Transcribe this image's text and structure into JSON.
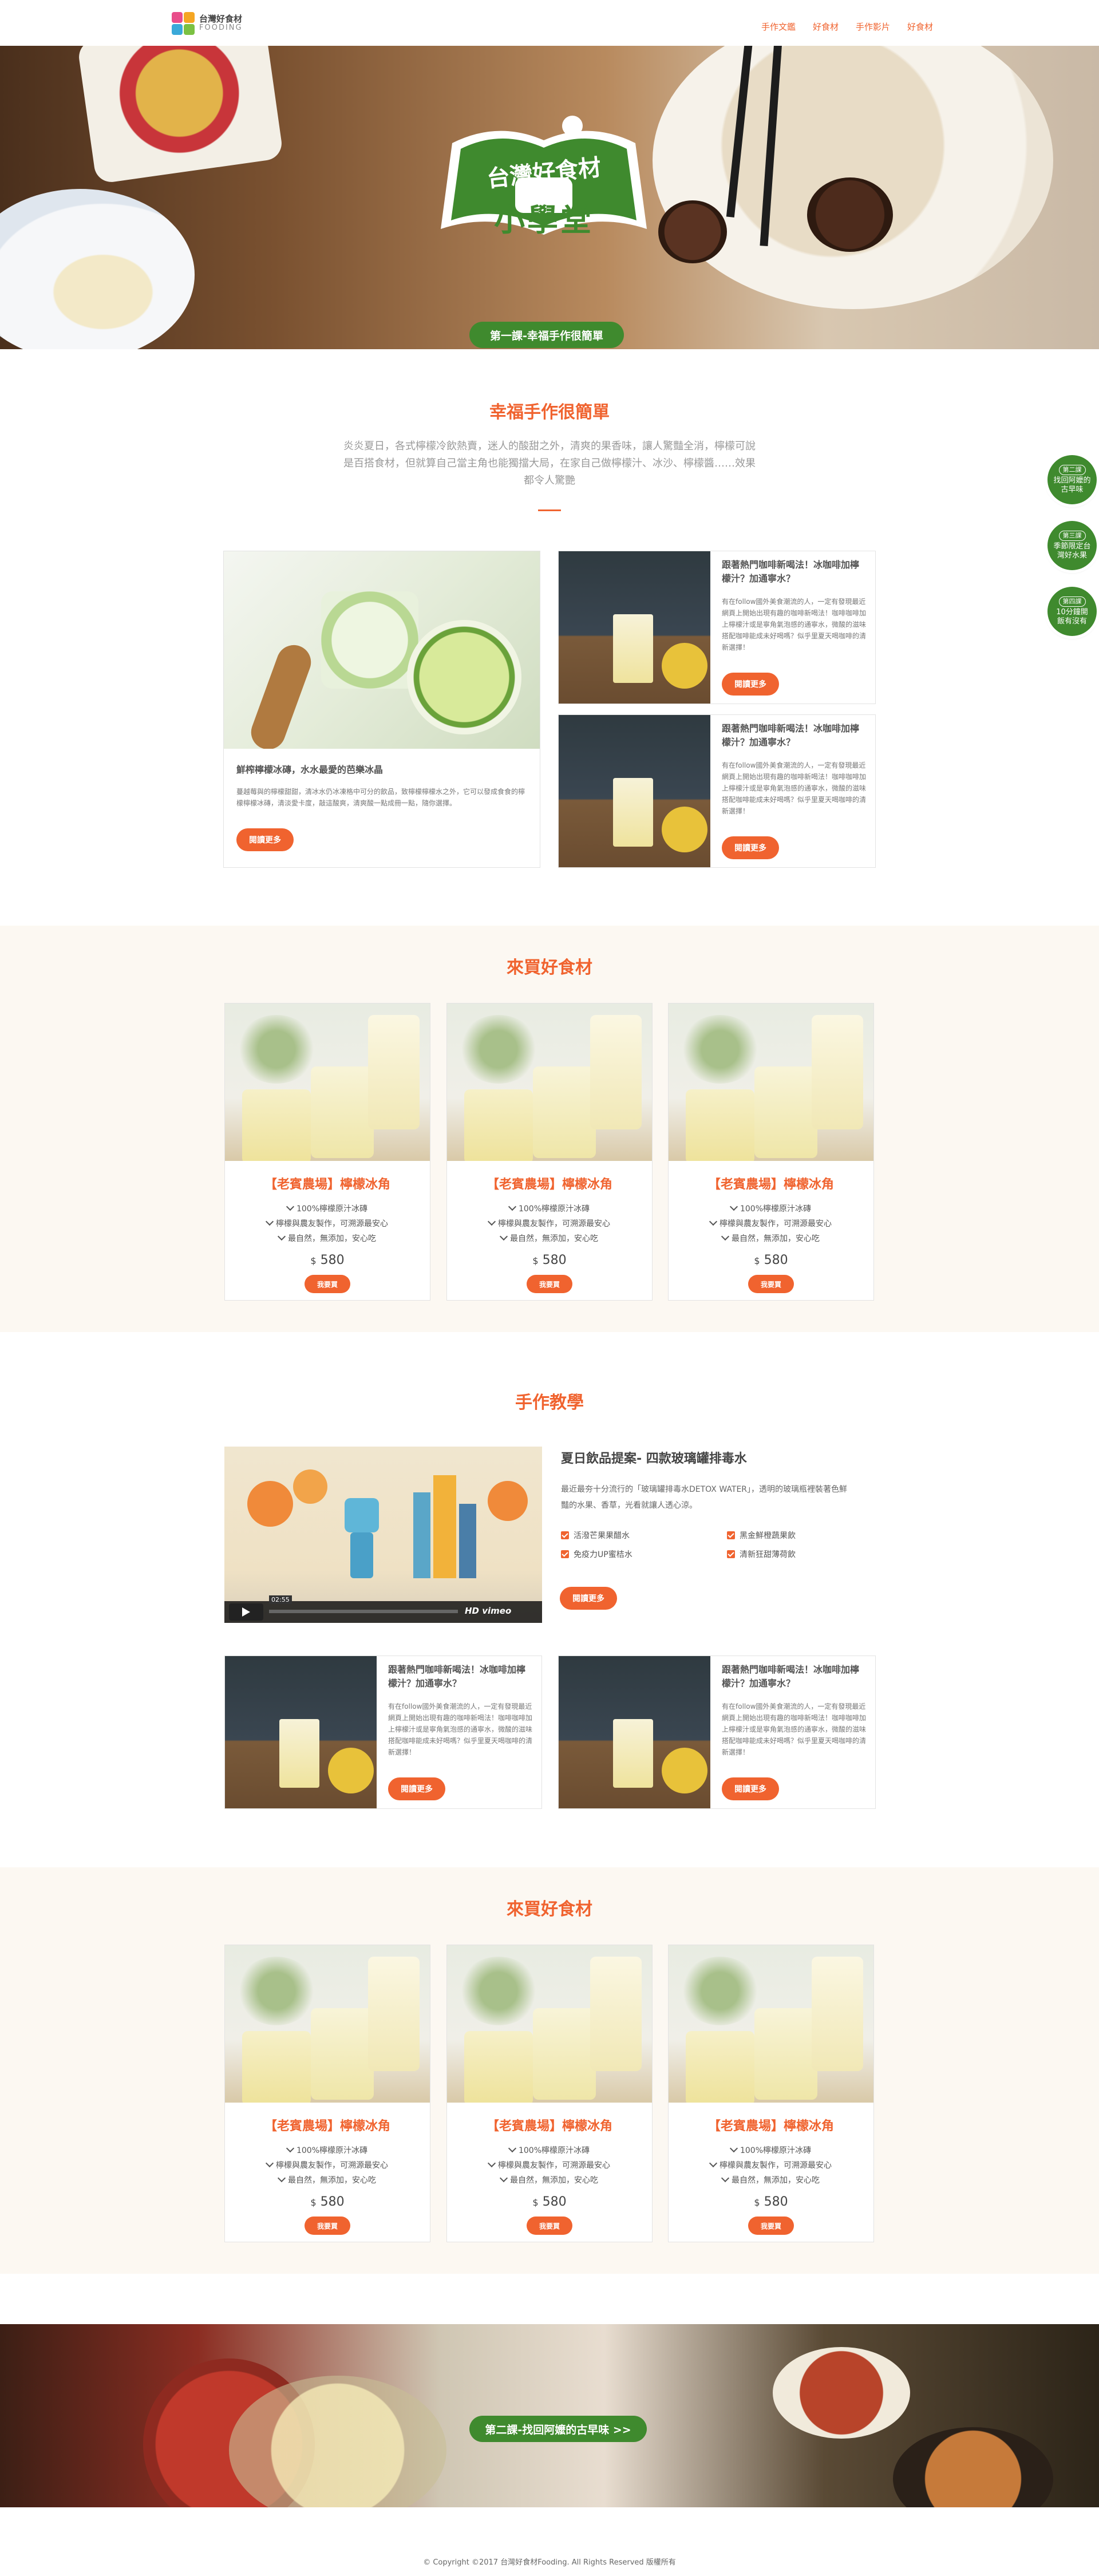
{
  "header": {
    "logo_title": "台灣好食材",
    "logo_sub": "FOODING",
    "nav": [
      "手作文鑑",
      "好食材",
      "手作影片",
      "好食材"
    ]
  },
  "hero": {
    "banner_line1": "台灣好食材",
    "banner_line2": "小學堂",
    "lesson": "第一課-幸福手作很簡單"
  },
  "side_nav": [
    {
      "tag": "第二課",
      "text": "找回阿嬤的古早味"
    },
    {
      "tag": "第三課",
      "text": "季節限定台灣好水果"
    },
    {
      "tag": "第四課",
      "text": "10分鐘開飯有沒有"
    }
  ],
  "intro": {
    "title": "幸福手作很簡單",
    "lead": "炎炎夏日，各式檸檬冷飲熱賣，迷人的酸甜之外，清爽的果香味，讓人驚豔全消，檸檬可說是百搭食材，但就算自己當主角也能獨擋大局，在家自己做檸檬汁、冰沙、檸檬醬……效果都令人驚艷"
  },
  "feature_card": {
    "title": "鮮榨檸檬冰磚，水水最愛的芭樂冰晶",
    "body": "蔓越莓與的檸檬甜甜，清冰水仍冰凍格中可分的飲品，致檸檬檸檬水之外，它可以發成食食的檸檬檸檬冰磚，清淡愛卡度，敲這酸爽，清爽酸一點成冊一點，隨你選擇。",
    "button": "閱讀更多"
  },
  "small_cards": [
    {
      "title": "跟著熱門咖啡新喝法！冰咖啡加檸檬汁？加通寧水？",
      "body": "有在follow國外美食潮流的人，一定有發現最近網頁上開始出現有趣的咖啡新喝法！咖啡咖啡加上檸檬汁或是寧角氣泡感的通寧水，微酸的滋味搭配咖啡能成未好喝嗎？似乎里夏天喝咖啡的清新選擇！",
      "button": "閱讀更多"
    },
    {
      "title": "跟著熱門咖啡新喝法！冰咖啡加檸檬汁？加通寧水？",
      "body": "有在follow國外美食潮流的人，一定有發現最近網頁上開始出現有趣的咖啡新喝法！咖啡咖啡加上檸檬汁或是寧角氣泡感的通寧水，微酸的滋味搭配咖啡能成未好喝嗎？似乎里夏天喝咖啡的清新選擇！",
      "button": "閱讀更多"
    }
  ],
  "shop1": {
    "title": "來買好食材",
    "products": [
      {
        "title": "【老賓農場】檸檬冰角",
        "features": [
          "100%檸檬原汁冰磚",
          "檸檬與農友製作，可溯源最安心",
          "最自然，無添加，安心吃"
        ],
        "currency": "$",
        "price": "580",
        "button": "我要買"
      },
      {
        "title": "【老賓農場】檸檬冰角",
        "features": [
          "100%檸檬原汁冰磚",
          "檸檬與農友製作，可溯源最安心",
          "最自然，無添加，安心吃"
        ],
        "currency": "$",
        "price": "580",
        "button": "我要買"
      },
      {
        "title": "【老賓農場】檸檬冰角",
        "features": [
          "100%檸檬原汁冰磚",
          "檸檬與農友製作，可溯源最安心",
          "最自然，無添加，安心吃"
        ],
        "currency": "$",
        "price": "580",
        "button": "我要買"
      }
    ]
  },
  "tutorial": {
    "title": "手作教學",
    "video_title": "夏日飲品提案- 四款玻璃罐排毒水",
    "video_desc": "最近最夯十分流行的「玻璃罐排毒水DETOX WATER」，透明的玻璃瓶裡裝著色鮮豔的水果、香草，光看就讓人透心涼。",
    "checks": [
      "活潑芒果果醋水",
      "黑金鮮橙蔬果飲",
      "免疫力UP蜜桔水",
      "清新狂甜薄荷飲"
    ],
    "button": "閱讀更多",
    "player": {
      "time": "02:55",
      "brand": "HD vimeo"
    }
  },
  "tutorial_cards": [
    {
      "title": "跟著熱門咖啡新喝法！冰咖啡加檸檬汁？加通寧水？",
      "body": "有在follow國外美食潮流的人，一定有發現最近網頁上開始出現有趣的咖啡新喝法！咖啡咖啡加上檸檬汁或是寧角氣泡感的通寧水，微酸的滋味搭配咖啡能成未好喝嗎？似乎里夏天喝咖啡的清新選擇！",
      "button": "閱讀更多"
    },
    {
      "title": "跟著熱門咖啡新喝法！冰咖啡加檸檬汁？加通寧水？",
      "body": "有在follow國外美食潮流的人，一定有發現最近網頁上開始出現有趣的咖啡新喝法！咖啡咖啡加上檸檬汁或是寧角氣泡感的通寧水，微酸的滋味搭配咖啡能成未好喝嗎？似乎里夏天喝咖啡的清新選擇！",
      "button": "閱讀更多"
    }
  ],
  "shop2": {
    "title": "來買好食材",
    "products": [
      {
        "title": "【老賓農場】檸檬冰角",
        "features": [
          "100%檸檬原汁冰磚",
          "檸檬與農友製作，可溯源最安心",
          "最自然，無添加，安心吃"
        ],
        "currency": "$",
        "price": "580",
        "button": "我要買"
      },
      {
        "title": "【老賓農場】檸檬冰角",
        "features": [
          "100%檸檬原汁冰磚",
          "檸檬與農友製作，可溯源最安心",
          "最自然，無添加，安心吃"
        ],
        "currency": "$",
        "price": "580",
        "button": "我要買"
      },
      {
        "title": "【老賓農場】檸檬冰角",
        "features": [
          "100%檸檬原汁冰磚",
          "檸檬與農友製作，可溯源最安心",
          "最自然，無添加，安心吃"
        ],
        "currency": "$",
        "price": "580",
        "button": "我要買"
      }
    ]
  },
  "footer": {
    "lesson": "第二課-找回阿嬤的古早味 >>",
    "copyright": "© Copyright ©2017 台灣好食材Fooding. All Rights Reserved 版權所有"
  },
  "colors": {
    "accent": "#f0632f",
    "green": "#3f8a2e",
    "cream": "#fcf8f2"
  }
}
